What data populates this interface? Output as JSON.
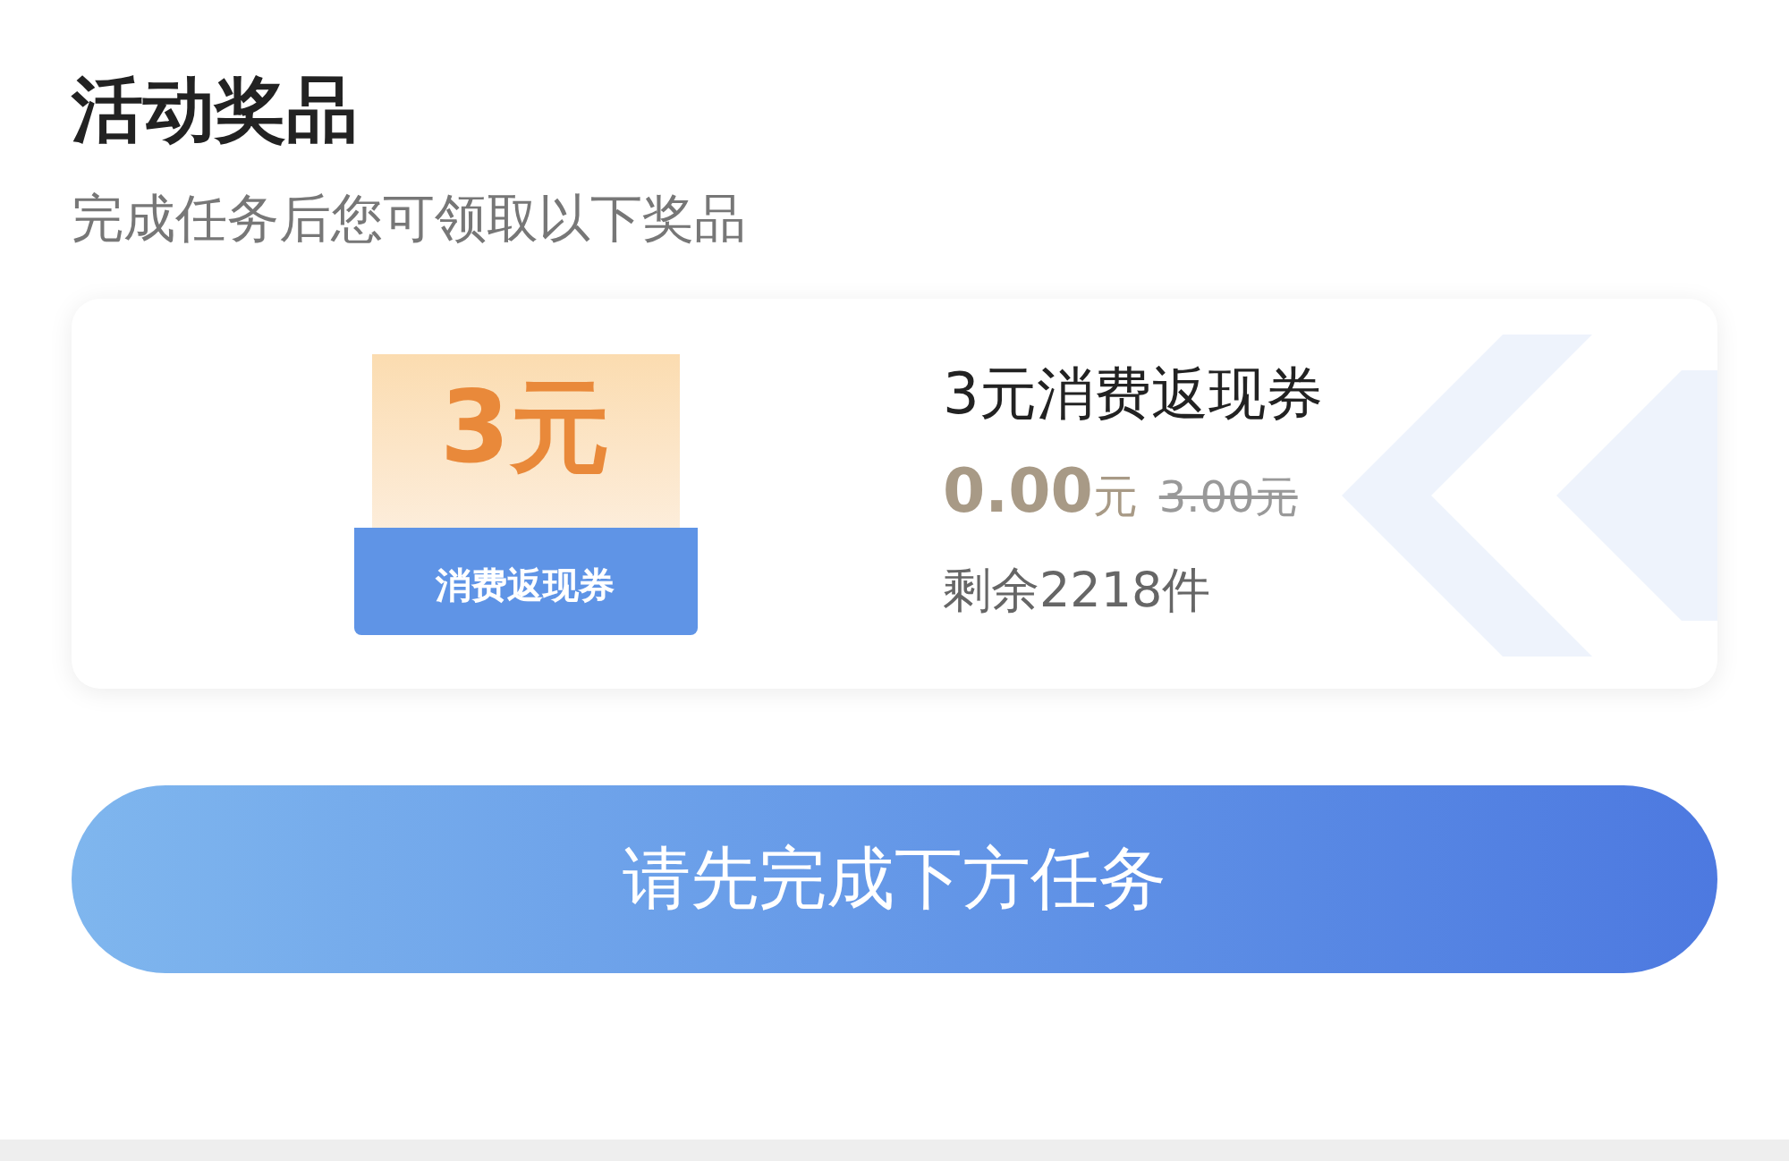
{
  "section": {
    "title": "活动奖品",
    "subtitle": "完成任务后您可领取以下奖品"
  },
  "prize": {
    "coupon_amount": "3元",
    "coupon_label": "消费返现券",
    "name": "3元消费返现券",
    "price": "0.00",
    "price_unit": "元",
    "original_price": "3.00元",
    "stock": "剩余2218件"
  },
  "action_button": "请先完成下方任务"
}
